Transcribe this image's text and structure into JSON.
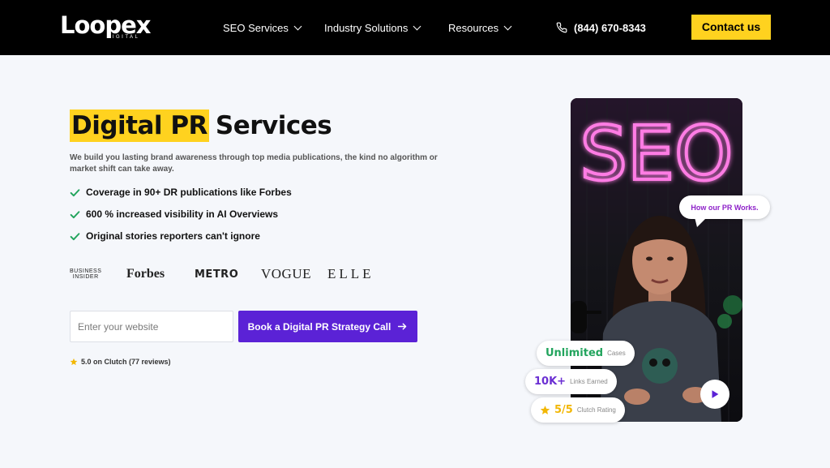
{
  "brand": {
    "name": "Loopex",
    "sub": "DIGITAL"
  },
  "nav": {
    "items": [
      {
        "label": "SEO Services"
      },
      {
        "label": "Industry Solutions"
      },
      {
        "label": "Resources"
      }
    ],
    "phone": "(844) 670-8343",
    "contact_label": "Contact us"
  },
  "hero": {
    "title_highlight": "Digital PR",
    "title_rest": "Services",
    "subtitle": "We build you lasting brand awareness through top media publications, the kind no algorithm or market shift can take away.",
    "bullets": [
      "Coverage in 90+ DR publications like Forbes",
      "600 % increased visibility in AI Overviews",
      "Original stories reporters can't ignore"
    ],
    "publications": {
      "business_insider_line1": "BUSINESS",
      "business_insider_line2": "INSIDER",
      "forbes": "Forbes",
      "metro": "METRO",
      "vogue": "VOGUE",
      "elle": "ELLE"
    },
    "input_placeholder": "Enter your website",
    "cta_label": "Book a Digital PR Strategy Call",
    "rating_text": "5.0 on Clutch (77 reviews)"
  },
  "video": {
    "neon_text": "SEO",
    "bubble": "How our PR Works.",
    "stats": [
      {
        "value": "Unlimited",
        "label": "Cases",
        "color": "#22a45d"
      },
      {
        "value": "10K+",
        "label": "Links Earned",
        "color": "#6b2fd3"
      },
      {
        "value": "5/5",
        "label": "Clutch Rating",
        "color": "#f2b705"
      }
    ]
  },
  "colors": {
    "accent_yellow": "#ffd21f",
    "accent_purple": "#5b22d6",
    "check_green": "#22a45d",
    "neon_pink": "#ff4fd8"
  }
}
